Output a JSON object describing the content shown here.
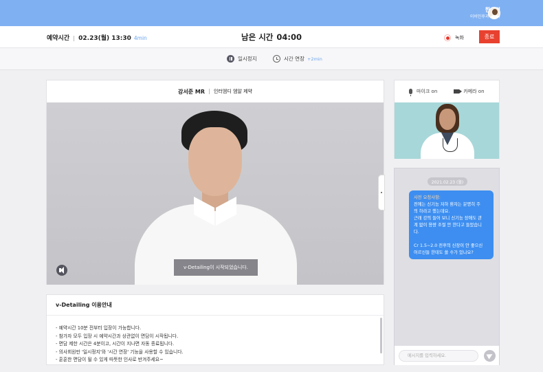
{
  "user": {
    "name": "한효정",
    "department": "이비인후과의학과"
  },
  "session": {
    "appointment_label": "예약시간",
    "appointment_time": "02.23(월) 13:30",
    "duration": "4min",
    "remaining_label": "남은 시간",
    "remaining_time": "04:00",
    "record_label": "녹화",
    "end_label": "종료"
  },
  "controls": {
    "pause_label": "일시정지",
    "extend_label": "시간 연장",
    "extend_amount": "+2min"
  },
  "main_video": {
    "presenter_name": "강서준 MR",
    "company": "인터엠디 엠알 제약",
    "toast": "v-Detailing이 시작되었습니다."
  },
  "guide": {
    "title": "v-Detailing 이용안내",
    "items": [
      "- 예약시간 10분 전부터 입장이 가능합니다.",
      "- 참가자 모두 입장 시 예약시간과 상관없이 면담이 시작됩니다.",
      "- 면담 제한 시간은 4분이고, 시간이 지나면 자동 종료됩니다.",
      "- 의사회원만 '일시정지'와 '시간 연장' 기능을 사용할 수 있습니다.",
      "- 훈훈한 면담이 될 수 있게 따뜻한 인사로 반겨주세요~"
    ]
  },
  "media": {
    "mic_label": "마이크 on",
    "camera_label": "카메라 on"
  },
  "chat": {
    "date": "2021.02.23 (월)",
    "message": {
      "label": "사전 요청사항:",
      "lines": [
        "전에는 신기능 저하 환자는 분명히 주",
        "의 하라고 했는데요.",
        "근래 강의 들어 보니 신기능 장애도 관",
        "계 없이 용량 조절 안 한다고 들었습니",
        "다.",
        "",
        "Cr 1.5~2.0 전후의 신장이 안 좋으신",
        "어르신들 한테도 쓸 수가 있나요?"
      ]
    },
    "input_placeholder": "메시지를 입력하세요."
  }
}
